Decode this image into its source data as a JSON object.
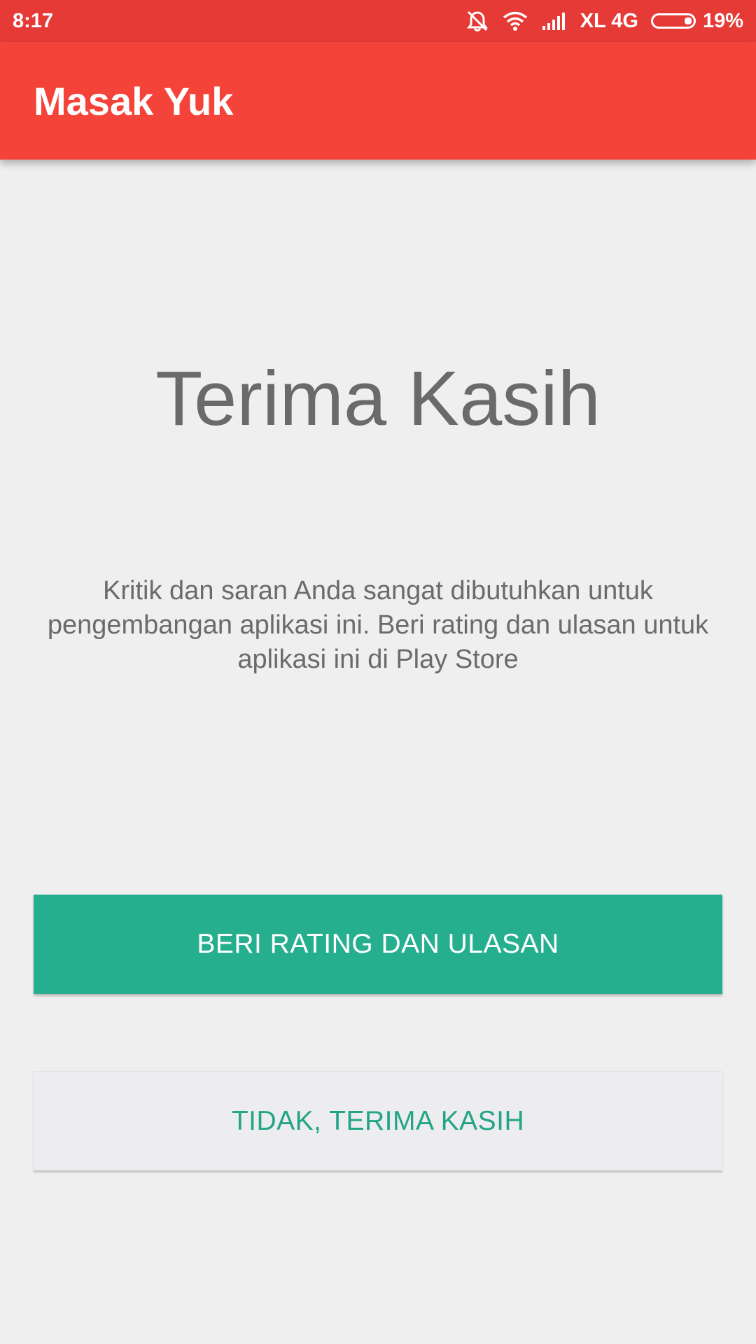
{
  "status_bar": {
    "time": "8:17",
    "carrier": "XL 4G",
    "battery_percent": "19%",
    "battery_level": 0.19,
    "icons": [
      "alarm-off-icon",
      "wifi-icon",
      "signal-icon",
      "battery-icon"
    ]
  },
  "app_bar": {
    "title": "Masak Yuk",
    "color": "#f4443a"
  },
  "main": {
    "headline": "Terima Kasih",
    "message": "Kritik dan saran Anda sangat dibutuhkan untuk pengembangan aplikasi ini. Beri rating dan ulasan untuk aplikasi ini di Play Store"
  },
  "actions": {
    "rate_label": "BERI RATING DAN ULASAN",
    "decline_label": "TIDAK, TERIMA KASIH",
    "accent_color": "#26af8e"
  }
}
